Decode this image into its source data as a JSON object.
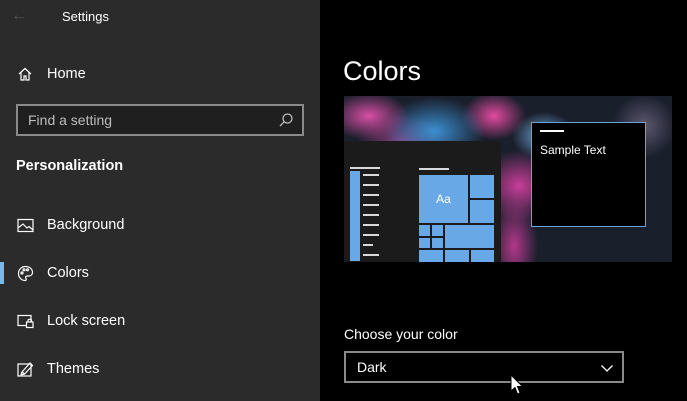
{
  "window": {
    "title": "Settings"
  },
  "sidebar": {
    "home_label": "Home",
    "search": {
      "placeholder": "Find a setting",
      "value": ""
    },
    "section_title": "Personalization",
    "items": [
      {
        "label": "Background",
        "icon": "image-icon",
        "active": false
      },
      {
        "label": "Colors",
        "icon": "palette-icon",
        "active": true
      },
      {
        "label": "Lock screen",
        "icon": "lock-screen-icon",
        "active": false
      },
      {
        "label": "Themes",
        "icon": "themes-icon",
        "active": false
      }
    ]
  },
  "main": {
    "page_title": "Colors",
    "preview": {
      "sample_text": "Sample Text",
      "tile_text": "Aa"
    },
    "choose_color": {
      "label": "Choose your color",
      "selected": "Dark"
    }
  },
  "colors": {
    "accent": "#76b9ed",
    "sidebar_bg": "#2b2b2b",
    "main_bg": "#000000"
  }
}
